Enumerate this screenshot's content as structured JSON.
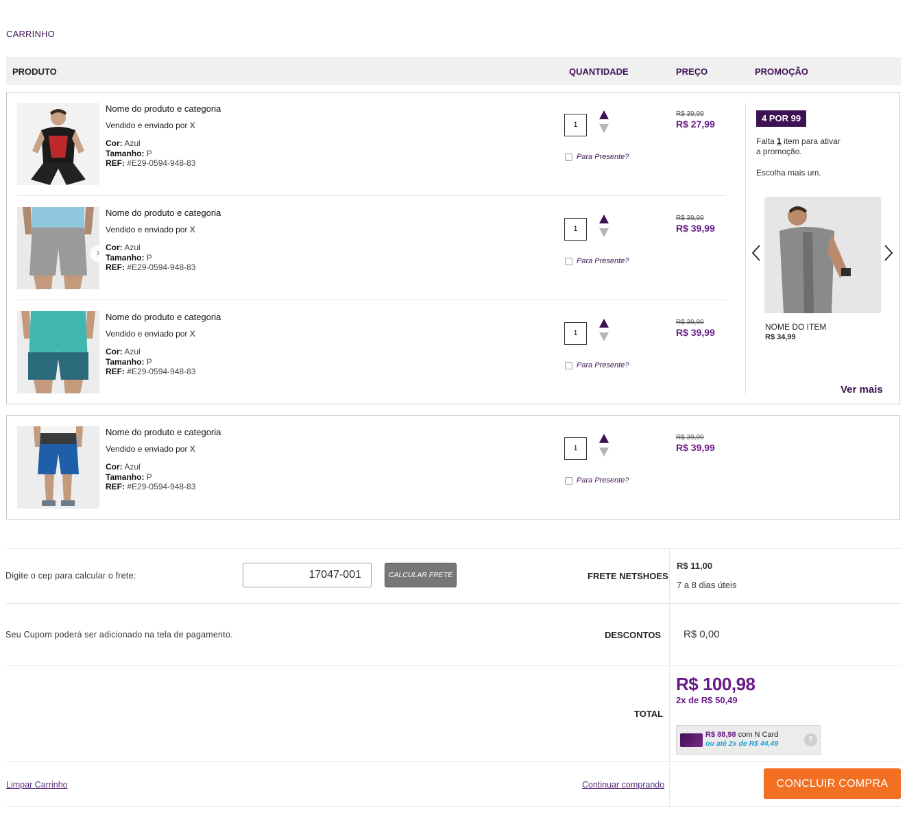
{
  "page": {
    "title": "CARRINHO"
  },
  "table_header": {
    "product": "PRODUTO",
    "quantity": "QUANTIDADE",
    "price": "PREÇO",
    "promotion": "PROMOÇÃO"
  },
  "items": [
    {
      "name": "Nome do produto e categoria",
      "seller": "Vendido e enviado por X",
      "color_label": "Cor:",
      "color": "Azul",
      "size_label": "Tamanho:",
      "size": "P",
      "ref_label": "REF:",
      "ref": "#E29-0594-948-83",
      "quantity": "1",
      "gift_label": "Para Presente?",
      "price_old": "R$ 39,99",
      "price_new": "R$ 27,99"
    },
    {
      "name": "Nome do produto e categoria",
      "seller": "Vendido e enviado por X",
      "color_label": "Cor:",
      "color": "Azul",
      "size_label": "Tamanho:",
      "size": "P",
      "ref_label": "REF:",
      "ref": "#E29-0594-948-83",
      "quantity": "1",
      "gift_label": "Para Presente?",
      "price_old": "R$ 39,99",
      "price_new": "R$ 39,99"
    },
    {
      "name": "Nome do produto e categoria",
      "seller": "Vendido e enviado por X",
      "color_label": "Cor:",
      "color": "Azul",
      "size_label": "Tamanho:",
      "size": "P",
      "ref_label": "REF:",
      "ref": "#E29-0594-948-83",
      "quantity": "1",
      "gift_label": "Para Presente?",
      "price_old": "R$ 39,99",
      "price_new": "R$ 39,99"
    },
    {
      "name": "Nome do produto e categoria",
      "seller": "Vendido e enviado por X",
      "color_label": "Cor:",
      "color": "Azul",
      "size_label": "Tamanho:",
      "size": "P",
      "ref_label": "REF:",
      "ref": "#E29-0594-948-83",
      "quantity": "1",
      "gift_label": "Para Presente?",
      "price_old": "R$ 39,99",
      "price_new": "R$ 39,99"
    }
  ],
  "promotion": {
    "badge": "4 POR 99",
    "missing_prefix": "Falta ",
    "missing_count": "1",
    "missing_suffix": " item para ativar",
    "missing_line2": "a promoção.",
    "choose_more": "Escolha mais um.",
    "item_name": "NOME DO ITEM",
    "item_price": "R$ 34,99",
    "see_more": "Ver mais"
  },
  "summary": {
    "cep_prompt": "Digite o cep para calcular o frete:",
    "cep_value": "17047-001",
    "calc_button": "CALCULAR FRETE",
    "shipping_label": "FRETE NETSHOES",
    "shipping_price": "R$ 11,00",
    "shipping_time": "7 a 8 dias úteis",
    "coupon_note": "Seu Cupom poderá ser adicionado na tela de pagamento.",
    "discount_label": "DESCONTOS",
    "discount_value": "R$ 0,00",
    "total_label": "TOTAL",
    "total_value": "R$ 100,98",
    "installments": "2x de  R$ 50,49",
    "ncard_price": "R$ 88,98",
    "ncard_with": " com N Card",
    "ncard_installments": "ou até 2x de R$ 44,49",
    "ncard_help": "?"
  },
  "actions": {
    "clear_cart": "Limpar Carrinho",
    "continue_shopping": "Continuar comprando",
    "checkout": "CONCLUIR COMPRA"
  },
  "colors": {
    "brand_purple": "#3d1152",
    "price_purple": "#6a1b8a",
    "checkout_orange": "#f36f21",
    "ncard_blue": "#1aa1d6"
  }
}
